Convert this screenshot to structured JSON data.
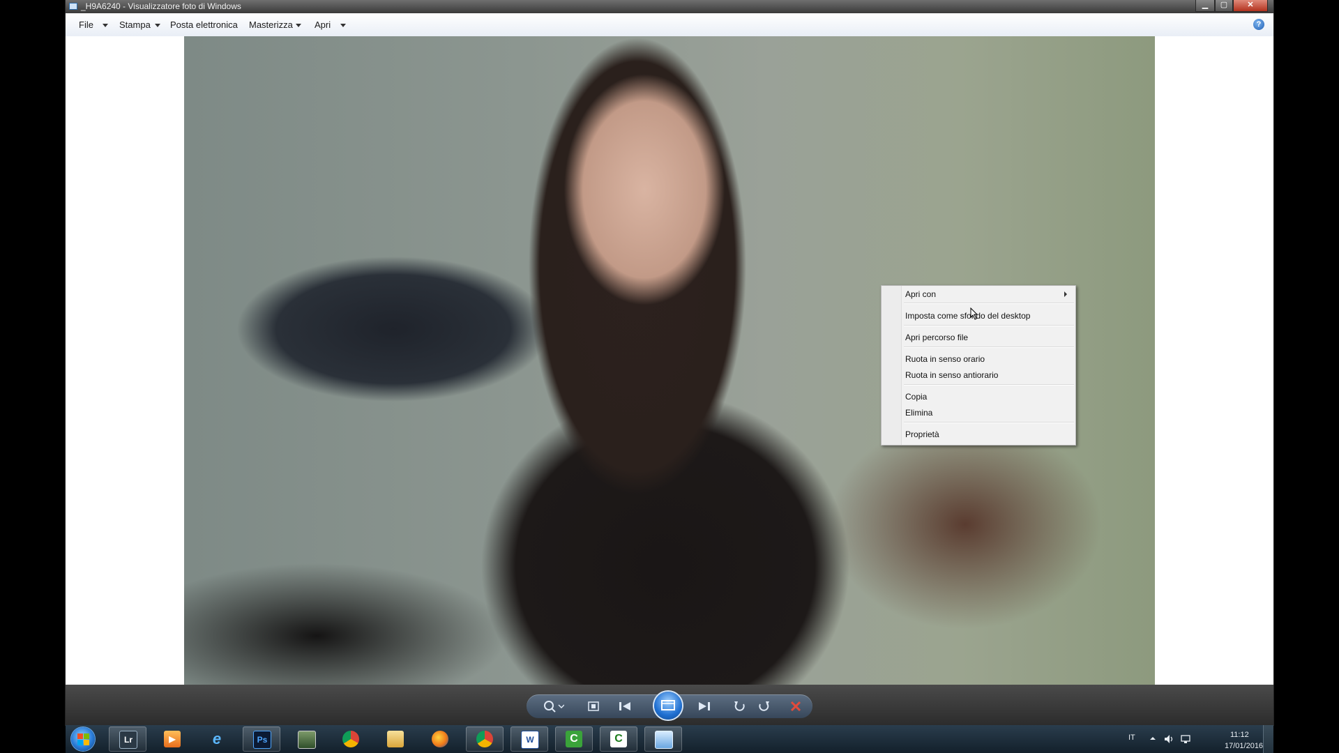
{
  "window": {
    "title": "_H9A6240 - Visualizzatore foto di Windows",
    "close_label": "✕"
  },
  "menubar": {
    "file": "File",
    "print": "Stampa",
    "email": "Posta elettronica",
    "burn": "Masterizza",
    "open": "Apri",
    "help": "?"
  },
  "context_menu": {
    "items": [
      "Apri con",
      "Imposta come sfondo del desktop",
      "Apri percorso file",
      "Ruota in senso orario",
      "Ruota in senso antiorario",
      "Copia",
      "Elimina",
      "Proprietà"
    ]
  },
  "controls": {
    "icons": [
      "zoom-icon",
      "fit-window-icon",
      "previous-icon",
      "slideshow-icon",
      "next-icon",
      "rotate-counterclockwise-icon",
      "rotate-clockwise-icon",
      "delete-icon"
    ]
  },
  "taskbar": {
    "apps": [
      {
        "name": "Lightroom",
        "label": "Lr"
      },
      {
        "name": "Media Player",
        "label": "▶"
      },
      {
        "name": "Internet Explorer",
        "label": "e"
      },
      {
        "name": "Photoshop",
        "label": "Ps"
      },
      {
        "name": "Monitor",
        "label": ""
      },
      {
        "name": "Chrome",
        "label": ""
      },
      {
        "name": "Explorer",
        "label": ""
      },
      {
        "name": "Firefox",
        "label": ""
      },
      {
        "name": "Chrome",
        "label": ""
      },
      {
        "name": "Word",
        "label": "W"
      },
      {
        "name": "Camtasia",
        "label": "C"
      },
      {
        "name": "Camtasia",
        "label": "C"
      },
      {
        "name": "Visualizzatore foto",
        "label": ""
      }
    ],
    "language": "IT",
    "time": "11:12",
    "date": "17/01/2016"
  },
  "colors": {
    "accent": "#1f6fd1",
    "taskbar": "#1b2a36",
    "close": "#c53a24"
  }
}
